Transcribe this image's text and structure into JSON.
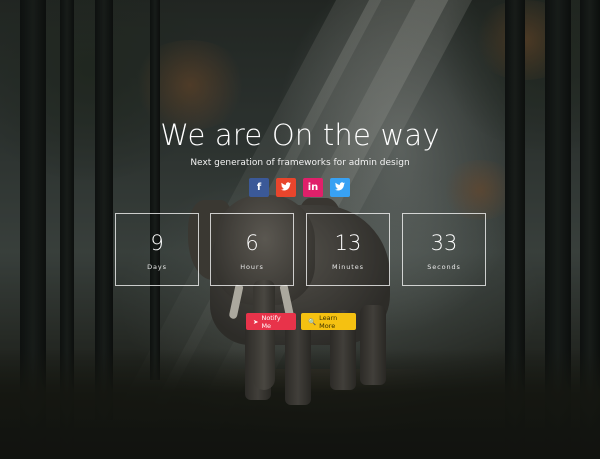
{
  "hero": {
    "title": "We are On the way",
    "subtitle": "Next generation of frameworks for admin design"
  },
  "social": [
    {
      "glyph": "f",
      "icon": "facebook-icon",
      "color": "#3b5998"
    },
    {
      "glyph": "🐦",
      "icon": "twitter-icon",
      "color": "#e8452c"
    },
    {
      "glyph": "in",
      "icon": "linkedin-icon",
      "color": "#e0206a"
    },
    {
      "glyph": "🐦",
      "icon": "twitter-icon",
      "color": "#38a1f3"
    }
  ],
  "countdown": [
    {
      "value": "9",
      "label": "Days"
    },
    {
      "value": "6",
      "label": "Hours"
    },
    {
      "value": "13",
      "label": "Minutes"
    },
    {
      "value": "33",
      "label": "Seconds"
    }
  ],
  "actions": {
    "notify": {
      "label": "Notify Me",
      "icon": "send-icon",
      "color": "#e8334a"
    },
    "learn": {
      "label": "Learn More",
      "icon": "search-icon",
      "color": "#f5c111"
    }
  }
}
